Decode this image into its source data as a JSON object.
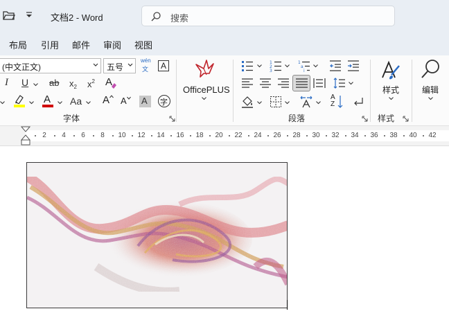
{
  "titlebar": {
    "folder_icon": "folder-open-icon",
    "dropdown_icon": "chevron-down-icon",
    "doc_title": "文档2  -  Word",
    "search_placeholder": "搜索"
  },
  "tabs": [
    "布局",
    "引用",
    "邮件",
    "审阅",
    "视图"
  ],
  "ribbon": {
    "font": {
      "font_name": "(中文正文)",
      "font_size": "五号",
      "phonetic_top": "wén",
      "phonetic_bottom": "文",
      "border_char": "A",
      "italic": "I",
      "underline": "U",
      "strike": "ab",
      "subscript": "x",
      "sub_mark": "2",
      "superscript": "x",
      "sup_mark": "2",
      "clear_format": "A",
      "font_color": "A",
      "change_case": "Aa",
      "grow": "A",
      "shrink": "A",
      "shading": "A",
      "enclosed": "字",
      "label": "字体"
    },
    "officeplus": {
      "label": "OfficePLUS"
    },
    "paragraph": {
      "label": "段落",
      "sort_top": "A",
      "sort_bottom": "Z"
    },
    "styles": {
      "button_label": "样式",
      "label": "样式"
    },
    "editing": {
      "button_label": "编辑"
    }
  },
  "ruler": {
    "ticks": [
      "2",
      "4",
      "6",
      "8",
      "10",
      "12",
      "14",
      "16",
      "18",
      "20",
      "22",
      "24",
      "26",
      "28",
      "30",
      "32",
      "34",
      "36",
      "38",
      "40",
      "42"
    ]
  },
  "document": {
    "image_description_icon": "abstract-fluid-art-picture"
  },
  "colors": {
    "chrome": "#e9eef4",
    "ribbon": "#fbfbfb",
    "highlight": "#ffff00",
    "font_color": "#d00000",
    "officeplus_red": "#c0262d",
    "paintbrush_blue": "#2b6cc4"
  }
}
